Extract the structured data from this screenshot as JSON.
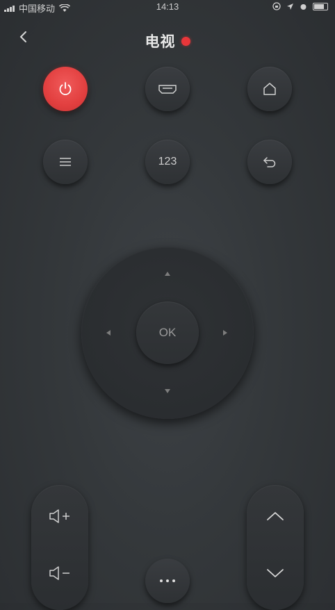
{
  "status_bar": {
    "carrier": "中国移动",
    "time": "14:13"
  },
  "header": {
    "title": "电视",
    "status_dot_color": "#e8363a"
  },
  "buttons": {
    "row1": [
      {
        "name": "power",
        "icon": "power-icon",
        "color": "#e23f3f"
      },
      {
        "name": "input-source",
        "icon": "hdmi-icon"
      },
      {
        "name": "home",
        "icon": "home-icon"
      }
    ],
    "row2": [
      {
        "name": "menu",
        "icon": "menu-icon"
      },
      {
        "name": "number-pad",
        "label": "123"
      },
      {
        "name": "return",
        "icon": "return-icon"
      }
    ]
  },
  "dpad": {
    "ok_label": "OK"
  },
  "volume": {
    "up_icon": "volume-up-icon",
    "down_icon": "volume-down-icon"
  },
  "channel": {
    "up_icon": "chevron-up-icon",
    "down_icon": "chevron-down-icon"
  },
  "more": {
    "icon": "more-icon"
  }
}
